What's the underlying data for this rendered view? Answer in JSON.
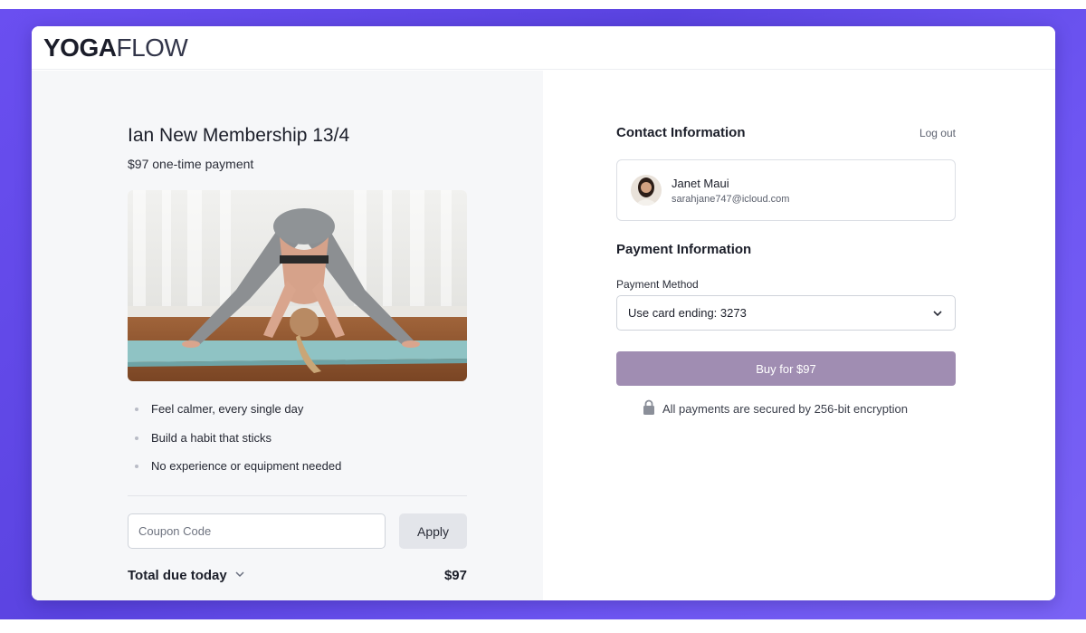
{
  "brand": {
    "logo_bold": "YOGA",
    "logo_light": "FLOW"
  },
  "product": {
    "title": "Ian New Membership 13/4",
    "subtitle": "$97 one-time payment",
    "features": [
      "Feel calmer, every single day",
      "Build a habit that sticks",
      "No experience or equipment needed"
    ]
  },
  "coupon": {
    "placeholder": "Coupon Code",
    "value": "",
    "apply_label": "Apply"
  },
  "total": {
    "label": "Total due today",
    "value": "$97"
  },
  "contact": {
    "section_title": "Contact Information",
    "logout_label": "Log out",
    "name": "Janet Maui",
    "email": "sarahjane747@icloud.com"
  },
  "payment": {
    "section_title": "Payment Information",
    "method_label": "Payment Method",
    "selected_method": "Use card ending: 3273",
    "buy_label": "Buy for $97",
    "security_note": "All payments are secured by 256-bit encryption"
  },
  "colors": {
    "background_accent": "#5f48e6",
    "buy_button": "#a08db2",
    "left_panel": "#f6f7f9"
  },
  "icons": [
    "chevron-down-icon",
    "lock-icon"
  ]
}
